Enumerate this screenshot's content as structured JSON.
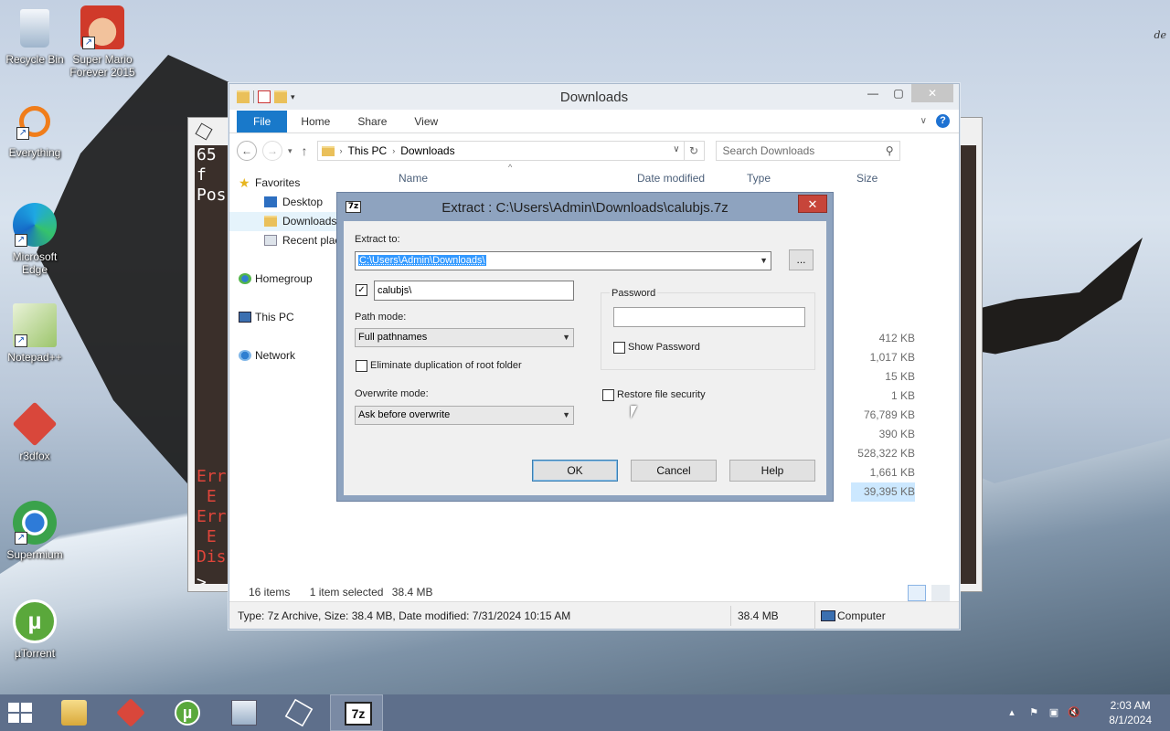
{
  "desktop": {
    "corner_text": "de",
    "icons": [
      {
        "label": "Recycle Bin",
        "icon": "recycle-bin-icon"
      },
      {
        "label": "Super Mario Forever 2015",
        "icon": "mario-icon"
      },
      {
        "label": "Everything",
        "icon": "everything-icon"
      },
      {
        "label": "Microsoft Edge",
        "icon": "edge-icon"
      },
      {
        "label": "Notepad++",
        "icon": "notepad-plus-plus-icon"
      },
      {
        "label": "r3dfox",
        "icon": "r3dfox-icon"
      },
      {
        "label": "Supermium",
        "icon": "supermium-icon"
      },
      {
        "label": "µTorrent",
        "icon": "utorrent-icon"
      }
    ]
  },
  "terminal": {
    "lines_top": [
      "65 f",
      "Pos"
    ],
    "lines_err": [
      "Err",
      " E",
      "Err",
      " E",
      "Dis"
    ],
    "prompt": ">"
  },
  "explorer": {
    "title": "Downloads",
    "ribbon_tabs": [
      "File",
      "Home",
      "Share",
      "View"
    ],
    "address": {
      "crumbs": [
        "This PC",
        "Downloads"
      ]
    },
    "search_placeholder": "Search Downloads",
    "nav": {
      "favorites": "Favorites",
      "desktop": "Desktop",
      "downloads": "Downloads",
      "recent": "Recent places",
      "homegroup": "Homegroup",
      "this_pc": "This PC",
      "network": "Network"
    },
    "columns": {
      "name": "Name",
      "date": "Date modified",
      "type": "Type",
      "size": "Size"
    },
    "file_sizes": [
      "412 KB",
      "1,017 KB",
      "15 KB",
      "1 KB",
      "76,789 KB",
      "390 KB",
      "528,322 KB",
      "1,661 KB",
      "39,395 KB"
    ],
    "status": {
      "items": "16 items",
      "selected": "1 item selected",
      "size": "38.4 MB"
    },
    "details": {
      "info": "Type: 7z Archive, Size: 38.4 MB, Date modified: 7/31/2024 10:15 AM",
      "size": "38.4 MB",
      "location": "Computer"
    }
  },
  "dialog": {
    "title": "Extract : C:\\Users\\Admin\\Downloads\\calubjs.7z",
    "logo": "7z",
    "extract_to_label": "Extract to:",
    "extract_to_value": "C:\\Users\\Admin\\Downloads\\",
    "browse_label": "...",
    "subfolder_checked": true,
    "subfolder_value": "calubjs\\",
    "path_mode_label": "Path mode:",
    "path_mode_value": "Full pathnames",
    "eliminate_label": "Eliminate duplication of root folder",
    "overwrite_label": "Overwrite mode:",
    "overwrite_value": "Ask before overwrite",
    "password_label": "Password",
    "show_password_label": "Show Password",
    "restore_security_label": "Restore file security",
    "ok_label": "OK",
    "cancel_label": "Cancel",
    "help_label": "Help"
  },
  "taskbar": {
    "apps": [
      "file-explorer-icon",
      "r3dfox-icon",
      "utorrent-icon",
      "task-manager-icon",
      "cube-app-icon",
      "7zip-icon"
    ],
    "active_label": "7z",
    "time": "2:03 AM",
    "date": "8/1/2024"
  }
}
